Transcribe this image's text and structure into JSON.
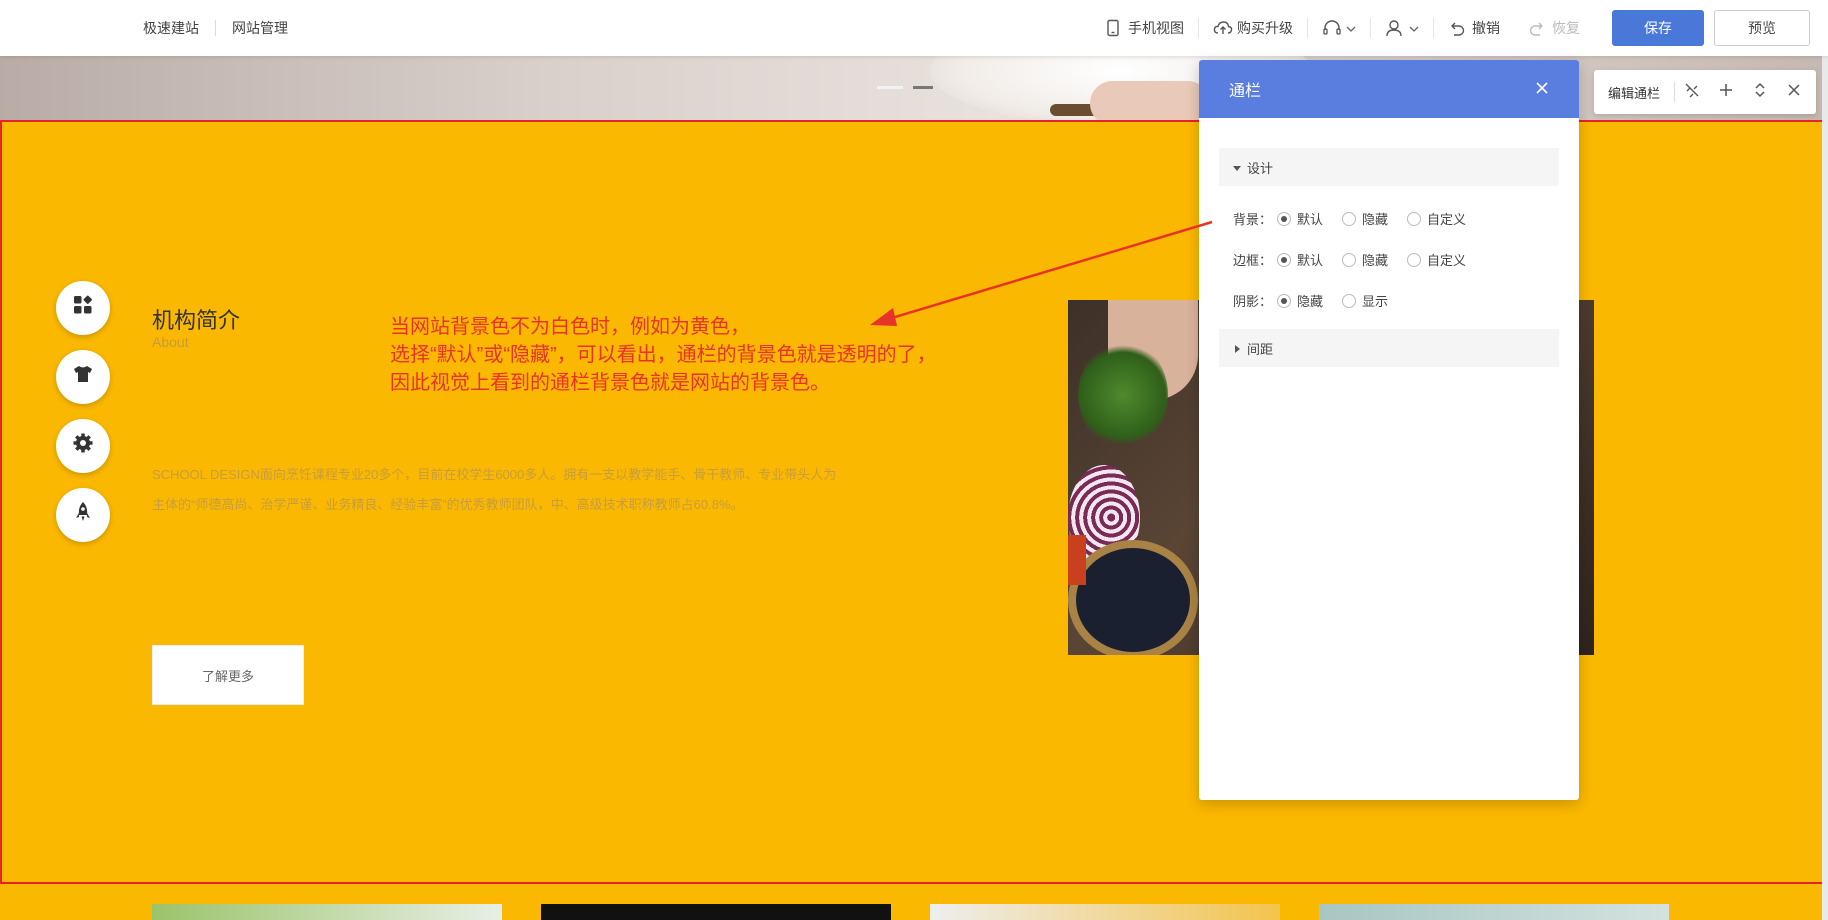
{
  "topbar": {
    "nav": [
      "极速建站",
      "网站管理"
    ],
    "mobile_view": "手机视图",
    "upgrade": "购买升级",
    "undo": "撤销",
    "redo": "恢复",
    "save": "保存",
    "preview": "预览"
  },
  "section": {
    "title": "机构简介",
    "subtitle": "About",
    "description": "SCHOOL DESIGN面向烹饪课程专业20多个，目前在校学生6000多人。拥有一支以教学能手、骨干教师、专业带头人为主体的“师德高尚、治学严谨、业务精良、经验丰富”的优秀教师团队，中、高级技术职称教师占60.8%。",
    "more_button": "了解更多"
  },
  "annotation": {
    "line1": "当网站背景色不为白色时，例如为黄色，",
    "line2": "选择“默认”或“隐藏”，可以看出，通栏的背景色就是透明的了，",
    "line3": "因此视觉上看到的通栏背景色就是网站的背景色。"
  },
  "panel": {
    "title": "通栏",
    "group_design": "设计",
    "group_spacing": "间距",
    "rows": [
      {
        "label": "背景：",
        "options": [
          "默认",
          "隐藏",
          "自定义"
        ],
        "selected": 0
      },
      {
        "label": "边框：",
        "options": [
          "默认",
          "隐藏",
          "自定义"
        ],
        "selected": 0
      },
      {
        "label": "阴影：",
        "options": [
          "隐藏",
          "显示"
        ],
        "selected": 0
      }
    ]
  },
  "edit_toolbar": {
    "label": "编辑通栏"
  },
  "colors": {
    "site_bg": "#fbb800",
    "accent": "#5a7de0",
    "highlight": "#e8222a"
  }
}
